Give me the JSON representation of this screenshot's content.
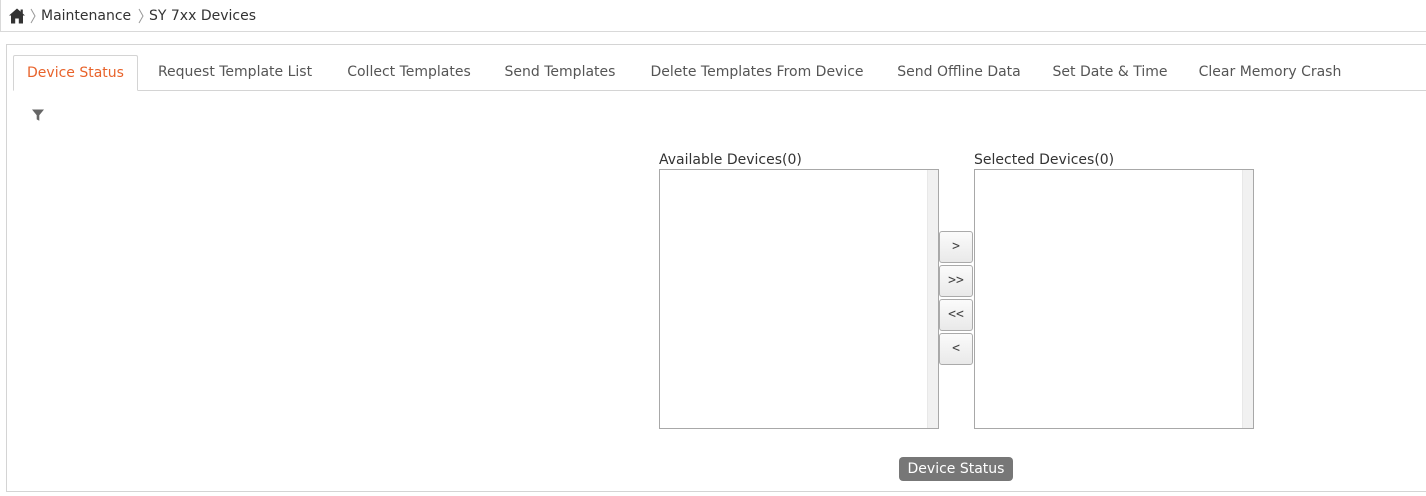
{
  "breadcrumb": {
    "items": [
      "Maintenance",
      "SY 7xx Devices"
    ]
  },
  "icons": {
    "home": "home-icon",
    "separator": "chevron-right-icon",
    "filter": "filter-icon"
  },
  "tabs": [
    {
      "label": "Device Status",
      "active": true
    },
    {
      "label": "Request Template List",
      "active": false
    },
    {
      "label": "Collect Templates",
      "active": false
    },
    {
      "label": "Send Templates",
      "active": false
    },
    {
      "label": "Delete Templates From Device",
      "active": false
    },
    {
      "label": "Send Offline Data",
      "active": false
    },
    {
      "label": "Set Date & Time",
      "active": false
    },
    {
      "label": "Clear Memory Crash",
      "active": false
    }
  ],
  "available": {
    "label": "Available Devices(0)",
    "items": []
  },
  "selected": {
    "label": "Selected Devices(0)",
    "items": []
  },
  "move_buttons": {
    "move_one_right": ">",
    "move_all_right": ">>",
    "move_all_left": "<<",
    "move_one_left": "<"
  },
  "action_button": {
    "label": "Device Status"
  },
  "colors": {
    "accent": "#e8632b",
    "button_bg": "#777777"
  }
}
